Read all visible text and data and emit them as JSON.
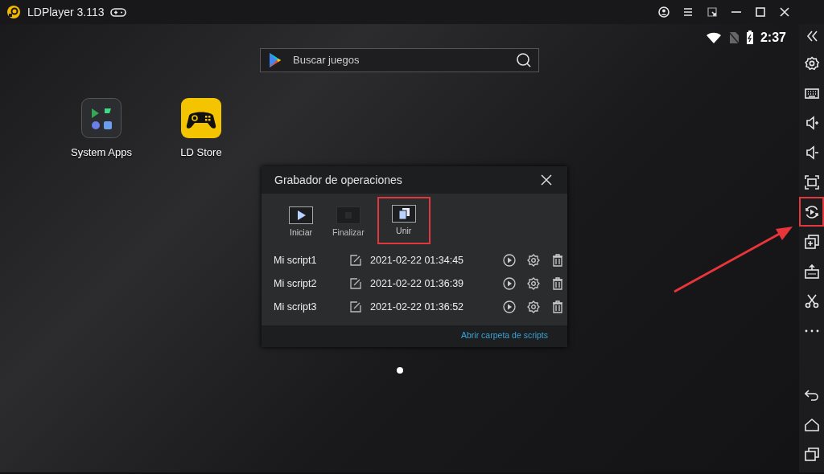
{
  "window": {
    "title": "LDPlayer 3.113",
    "controls": [
      {
        "kind": "account"
      },
      {
        "kind": "menu"
      },
      {
        "kind": "resize"
      },
      {
        "kind": "minimize"
      },
      {
        "kind": "maximize"
      },
      {
        "kind": "close"
      }
    ]
  },
  "status_bar": {
    "time": "2:37"
  },
  "search": {
    "placeholder": "Buscar juegos"
  },
  "apps": [
    {
      "kind": "folder",
      "label": "System Apps"
    },
    {
      "kind": "store",
      "label": "LD Store"
    }
  ],
  "dialog": {
    "title": "Grabador de operaciones",
    "tools": [
      {
        "kind": "play",
        "label": "Iniciar",
        "disabled": false,
        "highlighted": false
      },
      {
        "kind": "stop",
        "label": "Finalizar",
        "disabled": true,
        "highlighted": false
      },
      {
        "kind": "merge",
        "label": "Unir",
        "disabled": false,
        "highlighted": true
      }
    ],
    "scripts": [
      {
        "name": "Mi script1",
        "date": "2021-02-22 01:34:45"
      },
      {
        "name": "Mi script2",
        "date": "2021-02-22 01:36:39"
      },
      {
        "name": "Mi script3",
        "date": "2021-02-22 01:36:52"
      }
    ],
    "footer_link": "Abrir carpeta de scripts"
  },
  "sidebar": {
    "items": [
      {
        "kind": "collapse",
        "highlighted": false
      },
      {
        "kind": "settings",
        "highlighted": false
      },
      {
        "kind": "keyboard",
        "highlighted": false
      },
      {
        "kind": "volume-up",
        "highlighted": false
      },
      {
        "kind": "volume-down",
        "highlighted": false
      },
      {
        "kind": "fullscreen",
        "highlighted": false
      },
      {
        "kind": "recorder",
        "highlighted": true
      },
      {
        "kind": "multi",
        "highlighted": false
      },
      {
        "kind": "apk",
        "highlighted": false
      },
      {
        "kind": "scissors",
        "highlighted": false
      },
      {
        "kind": "more",
        "highlighted": false
      },
      {
        "kind": "spacer"
      },
      {
        "kind": "back",
        "highlighted": false
      },
      {
        "kind": "home",
        "highlighted": false
      },
      {
        "kind": "recent",
        "highlighted": false
      }
    ]
  }
}
